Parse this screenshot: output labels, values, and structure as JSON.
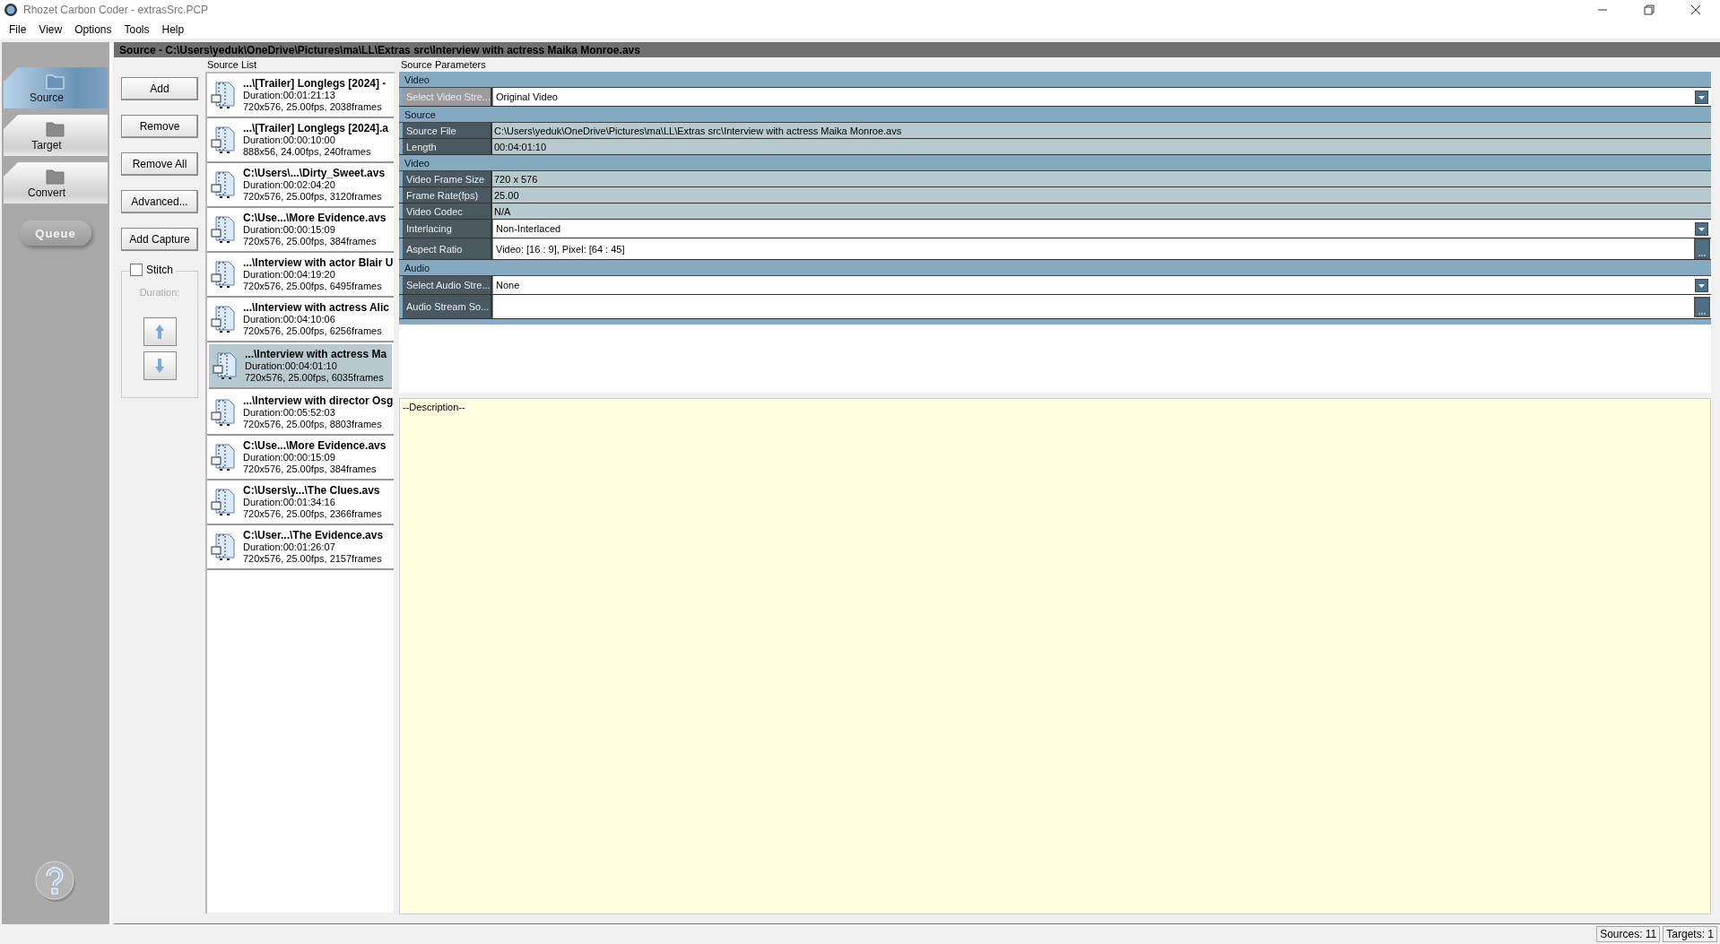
{
  "window": {
    "title": "Rhozet Carbon Coder - extrasSrc.PCP"
  },
  "menu": [
    "File",
    "View",
    "Options",
    "Tools",
    "Help"
  ],
  "nav": [
    {
      "label": "Source",
      "selected": true
    },
    {
      "label": "Target",
      "selected": false
    },
    {
      "label": "Convert",
      "selected": false
    }
  ],
  "queue_button": "Queue",
  "header": "Source - C:\\Users\\yeduk\\OneDrive\\Pictures\\ma\\LL\\Extras src\\Interview with actress Maika Monroe.avs",
  "buttons": [
    "Add",
    "Remove",
    "Remove All",
    "Advanced...",
    "Add Capture"
  ],
  "stitch": {
    "label": "Stitch",
    "checked": false,
    "duration_label": "Duration:",
    "disabled": true
  },
  "source_list": {
    "title": "Source List",
    "items": [
      {
        "name": "...\\[Trailer] Longlegs [2024] -",
        "duration": "Duration:00:01:21:13",
        "info": "720x576, 25.00fps, 2038frames",
        "selected": false
      },
      {
        "name": "...\\[Trailer] Longlegs [2024].a",
        "duration": "Duration:00:00:10:00",
        "info": "888x56, 24.00fps, 240frames",
        "selected": false
      },
      {
        "name": "C:\\Users\\...\\Dirty_Sweet.avs",
        "duration": "Duration:00:02:04:20",
        "info": "720x576, 25.00fps, 3120frames",
        "selected": false
      },
      {
        "name": "C:\\Use...\\More Evidence.avs",
        "duration": "Duration:00:00:15:09",
        "info": "720x576, 25.00fps, 384frames",
        "selected": false
      },
      {
        "name": "...\\Interview with actor Blair U",
        "duration": "Duration:00:04:19:20",
        "info": "720x576, 25.00fps, 6495frames",
        "selected": false
      },
      {
        "name": "...\\Interview with actress Alic",
        "duration": "Duration:00:04:10:06",
        "info": "720x576, 25.00fps, 6256frames",
        "selected": false
      },
      {
        "name": "...\\Interview with actress Ma",
        "duration": "Duration:00:04:01:10",
        "info": "720x576, 25.00fps, 6035frames",
        "selected": true
      },
      {
        "name": "...\\Interview with director Osg",
        "duration": "Duration:00:05:52:03",
        "info": "720x576, 25.00fps, 8803frames",
        "selected": false
      },
      {
        "name": "C:\\Use...\\More Evidence.avs",
        "duration": "Duration:00:00:15:09",
        "info": "720x576, 25.00fps, 384frames",
        "selected": false
      },
      {
        "name": "C:\\Users\\y...\\The Clues.avs",
        "duration": "Duration:00:01:34:16",
        "info": "720x576, 25.00fps, 2366frames",
        "selected": false
      },
      {
        "name": "C:\\User...\\The Evidence.avs",
        "duration": "Duration:00:01:26:07",
        "info": "720x576, 25.00fps, 2157frames",
        "selected": false
      }
    ]
  },
  "source_parameters": {
    "title": "Source Parameters",
    "rows": [
      {
        "kind": "section",
        "label": "Video"
      },
      {
        "kind": "dropdown",
        "label": "Select Video Stre...",
        "value": "Original Video",
        "selected": true
      },
      {
        "kind": "section",
        "label": "Source"
      },
      {
        "kind": "readonly",
        "label": "Source File",
        "value": "C:\\Users\\yeduk\\OneDrive\\Pictures\\ma\\LL\\Extras src\\Interview with actress Maika Monroe.avs",
        "selected": false
      },
      {
        "kind": "readonly",
        "label": "Length",
        "value": "00:04:01:10",
        "selected": false
      },
      {
        "kind": "section",
        "label": "Video"
      },
      {
        "kind": "readonly",
        "label": "Video Frame Size",
        "value": "720 x 576",
        "selected": false
      },
      {
        "kind": "readonly",
        "label": "Frame Rate(fps)",
        "value": "25.00",
        "selected": false
      },
      {
        "kind": "readonly",
        "label": "Video Codec",
        "value": "N/A",
        "selected": false
      },
      {
        "kind": "dropdown",
        "label": "Interlacing",
        "value": "Non-Interlaced",
        "selected": false
      },
      {
        "kind": "browse",
        "label": "Aspect Ratio",
        "value": "Video: [16 : 9], Pixel: [64 : 45]",
        "selected": false
      },
      {
        "kind": "section",
        "label": "Audio"
      },
      {
        "kind": "dropdown",
        "label": "Select Audio Stre...",
        "value": "None",
        "selected": false
      },
      {
        "kind": "browse",
        "label": "Audio Stream So...",
        "selected": false
      }
    ]
  },
  "description": "--Description--",
  "status_bar": [
    "Sources: 11",
    "Targets: 1"
  ]
}
